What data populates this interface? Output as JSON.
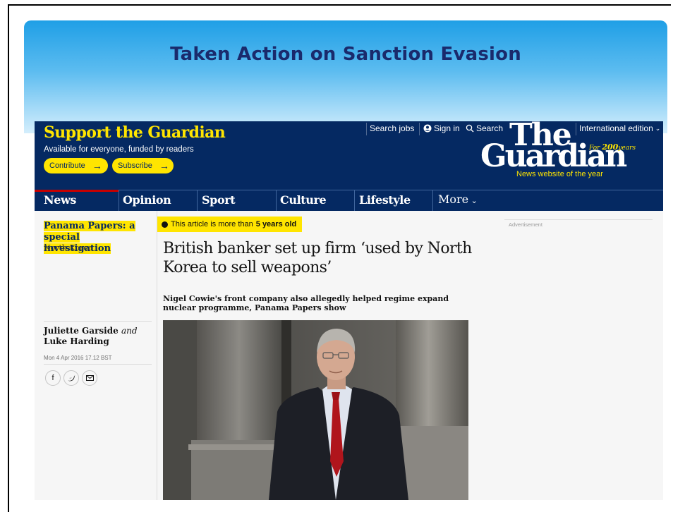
{
  "slide": {
    "title": "Taken Action on Sanction Evasion"
  },
  "masthead": {
    "support_title": "Support the Guardian",
    "support_subtitle": "Available for everyone, funded by readers",
    "contribute_label": "Contribute",
    "subscribe_label": "Subscribe",
    "search_jobs": "Search jobs",
    "sign_in": "Sign in",
    "search": "Search",
    "edition": "International edition",
    "logo_line1": "The",
    "logo_line2": "Guardian",
    "logo_for": "For",
    "logo_200": "200",
    "logo_years": "years",
    "logo_tagline": "News website of the year"
  },
  "nav": {
    "items": [
      "News",
      "Opinion",
      "Sport",
      "Culture",
      "Lifestyle"
    ],
    "more": "More",
    "active": "News"
  },
  "article": {
    "section_tag": "Panama Papers: a special investigation",
    "section_sub": "North Korea",
    "author1": "Juliette Garside",
    "author_and": "and",
    "author2": "Luke Harding",
    "date": "Mon 4 Apr 2016 17.12 BST",
    "age_prefix": "This article is more than",
    "age_value": "5 years old",
    "headline": "British banker set up firm ‘used by North Korea to sell weapons’",
    "standfirst": "Nigel Cowie's front company also allegedly helped regime expand nuclear programme, Panama Papers show",
    "advertisement": "Advertisement"
  },
  "icons": {
    "share": [
      "facebook-icon",
      "twitter-icon",
      "email-icon"
    ],
    "account": "account-icon",
    "search": "search-icon",
    "clock": "clock-icon"
  },
  "colors": {
    "guardian_blue": "#052962",
    "guardian_yellow": "#ffe500",
    "slide_title": "#1a2a6c",
    "nav_active": "#c70000"
  }
}
